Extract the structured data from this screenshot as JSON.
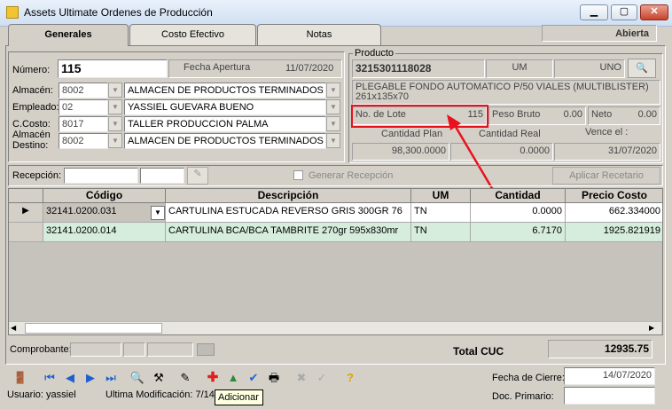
{
  "window": {
    "title": "Assets Ultimate   Ordenes de Producción",
    "minimize": "▁",
    "maximize": "▢",
    "close": "✕"
  },
  "tabs": [
    {
      "label": "Generales"
    },
    {
      "label": "Costo Efectivo"
    },
    {
      "label": "Notas"
    }
  ],
  "status": "Abierta",
  "form": {
    "numero_label": "Número:",
    "numero": "115",
    "fecha_apertura_label": "Fecha Apertura",
    "fecha_apertura": "11/07/2020",
    "almacen_label": "Almacén:",
    "almacen_code": "8002",
    "almacen_name": "ALMACEN DE PRODUCTOS TERMINADOS F",
    "empleado_label": "Empleado:",
    "empleado_code": "02",
    "empleado_name": "YASSIEL GUEVARA BUENO",
    "ccosto_label": "C.Costo:",
    "ccosto_code": "8017",
    "ccosto_name": "TALLER PRODUCCION PALMA",
    "almacen_destino_label_1": "Almacén",
    "almacen_destino_label_2": "Destino:",
    "almacen_destino_code": "8002",
    "almacen_destino_name": "ALMACEN DE PRODUCTOS TERMINADOS F"
  },
  "producto": {
    "group_label": "Producto",
    "code": "3215301118028",
    "um_label": "UM",
    "um": "UNO",
    "description_1": "PLEGABLE FONDO AUTOMATICO P/50 VIALES (MULTIBLISTER)",
    "description_2": "261x135x70",
    "lote_label": "No. de Lote",
    "lote": "115",
    "peso_bruto_label": "Peso Bruto",
    "peso_bruto": "0.00",
    "neto_label": "Neto",
    "neto": "0.00",
    "cantidad_plan_label": "Cantidad Plan",
    "cantidad_plan": "98,300.0000",
    "cantidad_real_label": "Cantidad Real",
    "cantidad_real": "0.0000",
    "vence_label": "Vence el :",
    "vence": "31/07/2020"
  },
  "recepcion": {
    "label": "Recepción:",
    "generar_label": "Generar Recepción",
    "aplicar_label": "Aplicar Recetario"
  },
  "grid": {
    "headers": [
      "Código",
      "Descripción",
      "UM",
      "Cantidad",
      "Precio Costo"
    ],
    "rows": [
      {
        "codigo": "32141.0200.031",
        "descripcion": "CARTULINA ESTUCADA REVERSO GRIS 300GR 76",
        "um": "TN",
        "cantidad": "0.0000",
        "precio": "662.334000"
      },
      {
        "codigo": "32141.0200.014",
        "descripcion": "CARTULINA BCA/BCA TAMBRITE 270gr 595x830mr",
        "um": "TN",
        "cantidad": "6.7170",
        "precio": "1925.821919"
      }
    ]
  },
  "footer": {
    "comprobante_label": "Comprobante:",
    "total_label": "Total  CUC",
    "total": "12935.75",
    "fecha_cierre_label": "Fecha de Cierre:",
    "fecha_cierre": "14/07/2020",
    "doc_primario_label": "Doc. Primario:",
    "usuario": "Usuario: yassiel",
    "ultima_mod": "Ultima Modificación: 7/14",
    "tooltip": "Adicionar"
  },
  "colors": {
    "highlight": "#e8121c",
    "row_alt": "#d6ecdc"
  }
}
